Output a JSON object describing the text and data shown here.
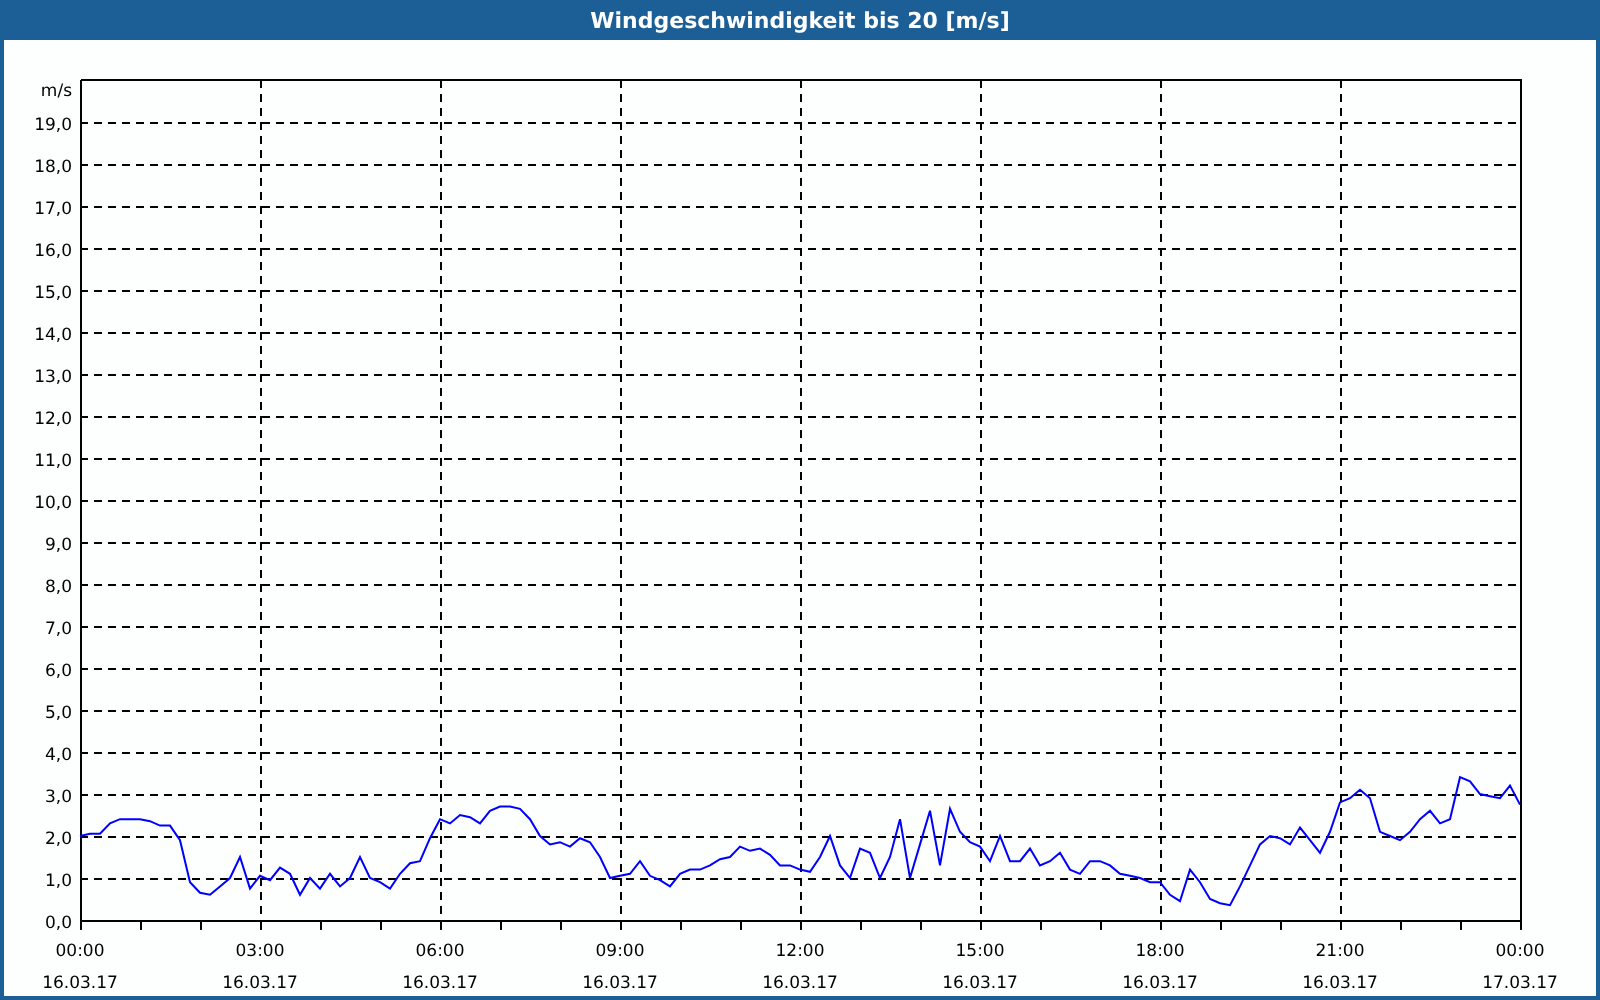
{
  "window": {
    "title": "Windgeschwindigkeit bis 20 [m/s]"
  },
  "chart": {
    "chart_data": {
      "type": "line",
      "grid": true,
      "ylabel": "m/s",
      "ylim": [
        0,
        20
      ],
      "yticks": [
        {
          "value": 0,
          "label": "0,0"
        },
        {
          "value": 1,
          "label": "1,0"
        },
        {
          "value": 2,
          "label": "2,0"
        },
        {
          "value": 3,
          "label": "3,0"
        },
        {
          "value": 4,
          "label": "4,0"
        },
        {
          "value": 5,
          "label": "5,0"
        },
        {
          "value": 6,
          "label": "6,0"
        },
        {
          "value": 7,
          "label": "7,0"
        },
        {
          "value": 8,
          "label": "8,0"
        },
        {
          "value": 9,
          "label": "9,0"
        },
        {
          "value": 10,
          "label": "10,0"
        },
        {
          "value": 11,
          "label": "11,0"
        },
        {
          "value": 12,
          "label": "12,0"
        },
        {
          "value": 13,
          "label": "13,0"
        },
        {
          "value": 14,
          "label": "14,0"
        },
        {
          "value": 15,
          "label": "15,0"
        },
        {
          "value": 16,
          "label": "16,0"
        },
        {
          "value": 17,
          "label": "17,0"
        },
        {
          "value": 18,
          "label": "18,0"
        },
        {
          "value": 19,
          "label": "19,0"
        }
      ],
      "categories": [
        "00:00\n16.03.17",
        null,
        null,
        null,
        null,
        null,
        null,
        null,
        null,
        null,
        null,
        null,
        null,
        null,
        null,
        null,
        null,
        null,
        "03:00\n16.03.17",
        null,
        null,
        null,
        null,
        null,
        null,
        null,
        null,
        null,
        null,
        null,
        null,
        null,
        null,
        null,
        null,
        null,
        "06:00\n16.03.17",
        null,
        null,
        null,
        null,
        null,
        null,
        null,
        null,
        null,
        null,
        null,
        null,
        null,
        null,
        null,
        null,
        null,
        "09:00\n16.03.17",
        null,
        null,
        null,
        null,
        null,
        null,
        null,
        null,
        null,
        null,
        null,
        null,
        null,
        null,
        null,
        null,
        null,
        "12:00\n16.03.17",
        null,
        null,
        null,
        null,
        null,
        null,
        null,
        null,
        null,
        null,
        null,
        null,
        null,
        null,
        null,
        null,
        null,
        "15:00\n16.03.17",
        null,
        null,
        null,
        null,
        null,
        null,
        null,
        null,
        null,
        null,
        null,
        null,
        null,
        null,
        null,
        null,
        null,
        "18:00\n16.03.17",
        null,
        null,
        null,
        null,
        null,
        null,
        null,
        null,
        null,
        null,
        null,
        null,
        null,
        null,
        null,
        null,
        null,
        "21:00\n16.03.17",
        null,
        null,
        null,
        null,
        null,
        null,
        null,
        null,
        null,
        null,
        null,
        null,
        null,
        null,
        null,
        null,
        null,
        "00:00\n17.03.17"
      ],
      "series": [
        {
          "color": "#0000ff",
          "values": [
            2.0,
            2.05,
            2.05,
            2.3,
            2.4,
            2.4,
            2.4,
            2.35,
            2.25,
            2.25,
            1.9,
            0.9,
            0.65,
            0.6,
            0.8,
            1.0,
            1.5,
            0.75,
            1.05,
            0.95,
            1.25,
            1.1,
            0.6,
            1.0,
            0.75,
            1.1,
            0.8,
            1.0,
            1.5,
            1.0,
            0.9,
            0.75,
            1.1,
            1.35,
            1.4,
            1.95,
            2.4,
            2.3,
            2.5,
            2.45,
            2.3,
            2.6,
            2.7,
            2.7,
            2.65,
            2.4,
            2.0,
            1.8,
            1.85,
            1.75,
            1.95,
            1.85,
            1.5,
            1.0,
            1.05,
            1.1,
            1.4,
            1.05,
            0.95,
            0.8,
            1.1,
            1.2,
            1.2,
            1.3,
            1.45,
            1.5,
            1.75,
            1.65,
            1.7,
            1.55,
            1.3,
            1.3,
            1.2,
            1.15,
            1.5,
            2.0,
            1.3,
            1.0,
            1.7,
            1.6,
            1.0,
            1.5,
            2.4,
            1.0,
            1.8,
            2.6,
            1.3,
            2.65,
            2.1,
            1.85,
            1.75,
            1.4,
            2.0,
            1.4,
            1.4,
            1.7,
            1.3,
            1.4,
            1.6,
            1.2,
            1.1,
            1.4,
            1.4,
            1.3,
            1.1,
            1.05,
            1.0,
            0.9,
            0.9,
            0.6,
            0.45,
            1.2,
            0.9,
            0.5,
            0.4,
            0.35,
            0.8,
            1.3,
            1.8,
            2.0,
            1.95,
            1.8,
            2.2,
            1.9,
            1.6,
            2.1,
            2.8,
            2.9,
            3.1,
            2.9,
            2.1,
            2.0,
            1.9,
            2.1,
            2.4,
            2.6,
            2.3,
            2.4,
            3.4,
            3.3,
            3.0,
            2.95,
            2.9,
            3.2,
            2.75
          ]
        }
      ]
    }
  }
}
